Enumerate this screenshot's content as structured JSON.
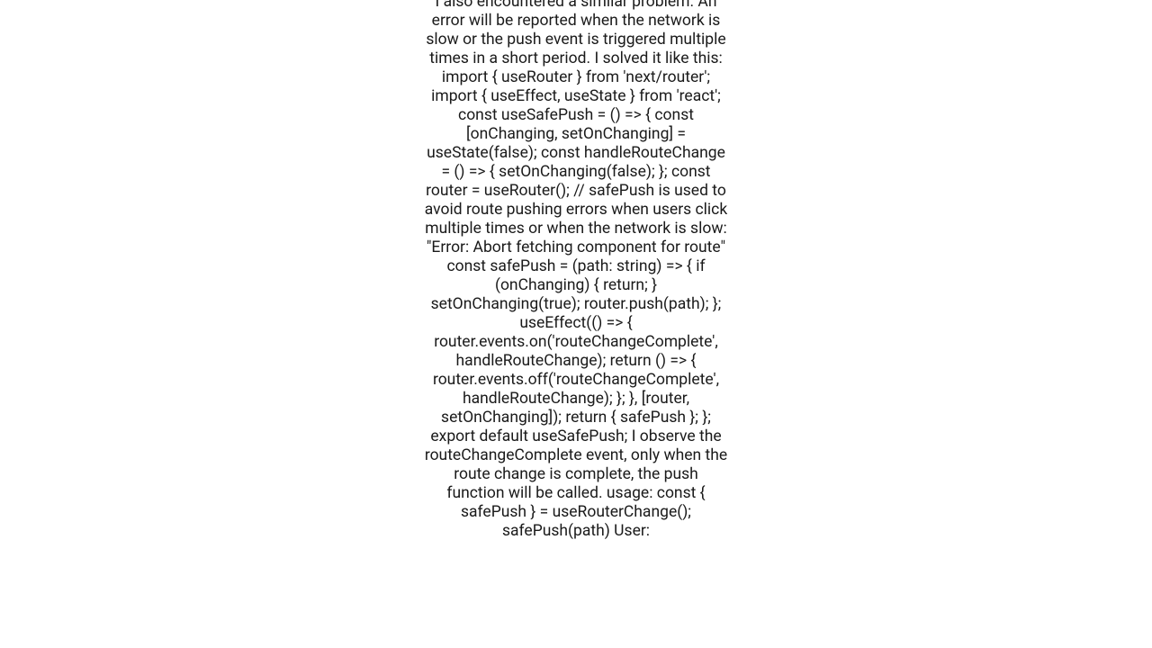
{
  "content": {
    "body": "I also encountered a similar problem. An error will be reported when the network is slow or the push event is triggered multiple times in a short period. I solved it like this: import { useRouter } from 'next/router'; import { useEffect, useState } from 'react';  const useSafePush = () => {   const [onChanging, setOnChanging] = useState(false);   const handleRouteChange = () => {     setOnChanging(false);   };   const router = useRouter();   // safePush is used to avoid route pushing errors when users click multiple times or when the network is slow:  \"Error: Abort fetching component for route\"   const safePush = (path: string) => {     if (onChanging) {       return;     }     setOnChanging(true);     router.push(path);   };    useEffect(() => {     router.events.on('routeChangeComplete', handleRouteChange);      return () => {       router.events.off('routeChangeComplete', handleRouteChange);     };   }, [router, setOnChanging]);   return { safePush }; };  export default useSafePush;  I observe the routeChangeComplete event, only when the route change is complete, the push function will be called. usage: const { safePush } = useRouterChange(); safePush(path)   User:"
  }
}
